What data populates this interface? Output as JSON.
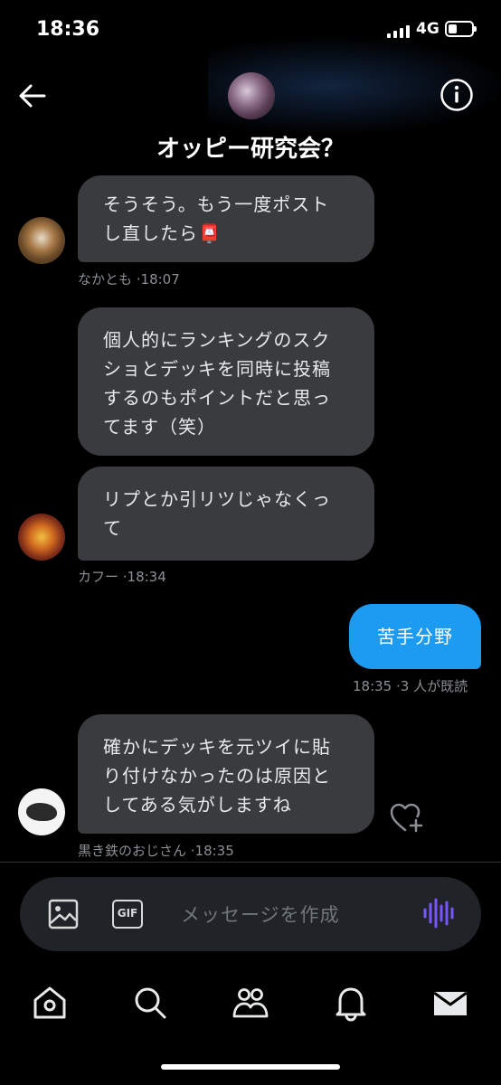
{
  "status_bar": {
    "time": "18:36",
    "network": "4G"
  },
  "header": {
    "title": "オッピー研究会？"
  },
  "messages": [
    {
      "text": "そうそう。もう一度ポスト\nし直したら📮",
      "sender": "なかとも",
      "time": "18:07",
      "meta": "なかとも ·18:07"
    },
    {
      "text": "個人的にランキングのスク\nショとデッキを同時に投稿\nするのもポイントだと思っ\nてます（笑）"
    },
    {
      "text": "リプとか引リツじゃなくっ\nて",
      "sender": "カフー",
      "time": "18:34",
      "meta": "カフー ·18:34"
    },
    {
      "text": "苦手分野",
      "outgoing": true,
      "time": "18:35",
      "meta": "18:35 ·3 人が既読"
    },
    {
      "text": "確かにデッキを元ツイに貼\nり付けなかったのは原因と\nしてある気がしますね",
      "sender": "黒き鉄のおじさん",
      "time": "18:35",
      "meta": "黒き鉄のおじさん ·18:35"
    }
  ],
  "composer": {
    "placeholder": "メッセージを作成",
    "gif_label": "GIF"
  },
  "tab_bar": {
    "items": [
      "home-icon",
      "search-icon",
      "communities-icon",
      "notifications-icon",
      "messages-icon"
    ]
  },
  "colors": {
    "sent_bubble": "#1d9bf0",
    "received_bubble": "#3a3b3f",
    "background": "#000000",
    "voice_accent": "#7856ff"
  }
}
